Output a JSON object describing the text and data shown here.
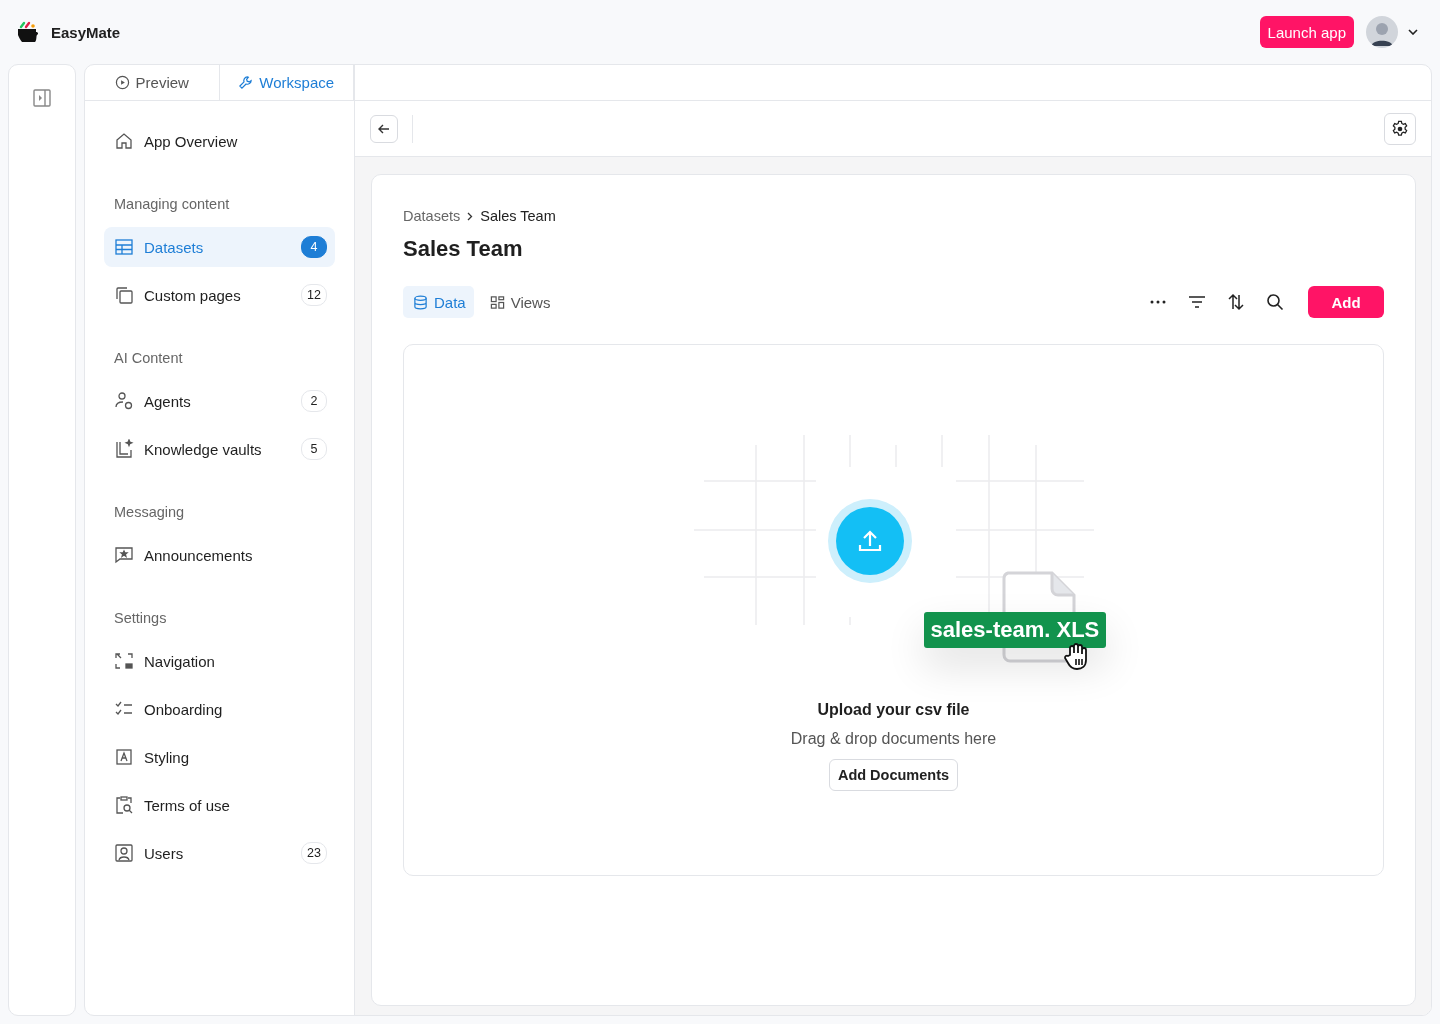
{
  "app": {
    "name": "EasyMate",
    "launch_button": "Launch app"
  },
  "panel_tabs": [
    {
      "label": "Preview",
      "selected": false
    },
    {
      "label": "Workspace",
      "selected": true
    }
  ],
  "sidebar": {
    "sections": [
      {
        "items": [
          {
            "label": "App Overview",
            "selected": false
          }
        ]
      },
      {
        "heading": "Managing content",
        "items": [
          {
            "label": "Datasets",
            "count": "4",
            "selected": true
          },
          {
            "label": "Custom pages",
            "count": "12",
            "selected": false
          }
        ]
      },
      {
        "heading": "AI Content",
        "items": [
          {
            "label": "Agents",
            "count": "2",
            "selected": false
          },
          {
            "label": "Knowledge vaults",
            "count": "5",
            "selected": false
          }
        ]
      },
      {
        "heading": "Messaging",
        "items": [
          {
            "label": "Announcements",
            "selected": false
          }
        ]
      },
      {
        "heading": "Settings",
        "items": [
          {
            "label": "Navigation",
            "selected": false
          },
          {
            "label": "Onboarding",
            "selected": false
          },
          {
            "label": "Styling",
            "selected": false
          },
          {
            "label": "Terms of use",
            "selected": false
          },
          {
            "label": "Users",
            "count": "23",
            "selected": false
          }
        ]
      }
    ]
  },
  "breadcrumb": [
    "Datasets",
    "Sales Team"
  ],
  "title": "Sales Team",
  "view_tabs": [
    {
      "label": "Data",
      "selected": true
    },
    {
      "label": "Views",
      "selected": false
    }
  ],
  "add_button": "Add",
  "upload": {
    "file_label": "sales-team. XLS",
    "heading": "Upload your csv file",
    "hint": "Drag & drop documents here",
    "button": "Add Documents"
  }
}
